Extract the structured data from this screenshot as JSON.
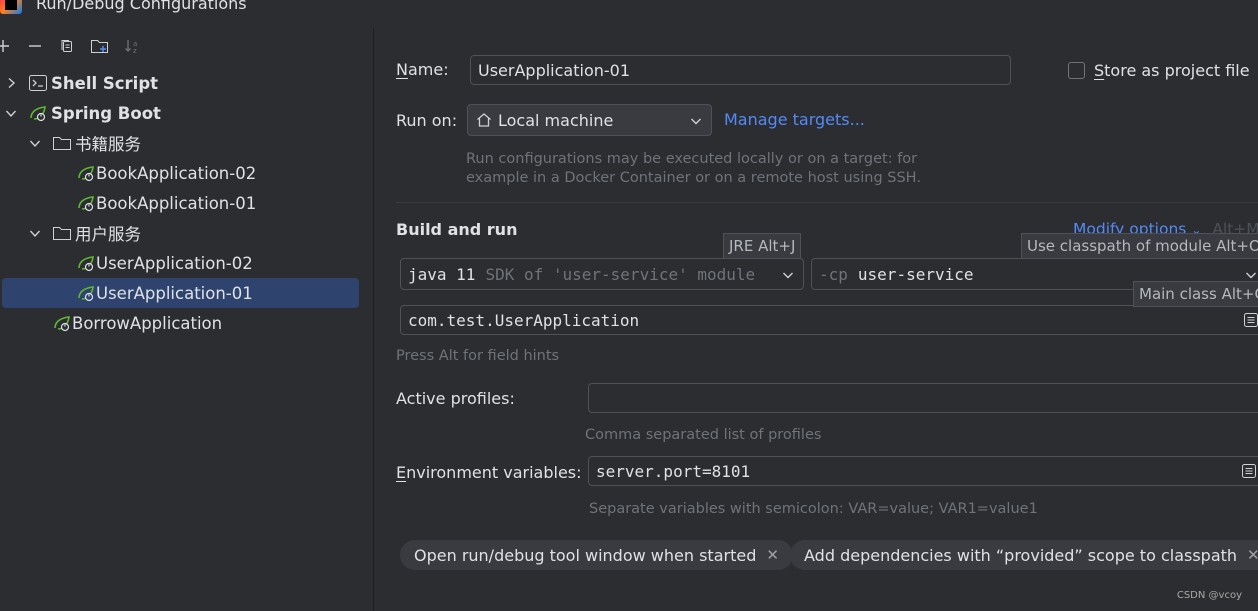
{
  "window": {
    "title": "Run/Debug Configurations"
  },
  "tree": {
    "nodes": [
      {
        "label": "Shell Script"
      },
      {
        "label": "Spring Boot"
      },
      {
        "label": "书籍服务"
      },
      {
        "label": "BookApplication-02"
      },
      {
        "label": "BookApplication-01"
      },
      {
        "label": "用户服务"
      },
      {
        "label": "UserApplication-02"
      },
      {
        "label": "UserApplication-01"
      },
      {
        "label": "BorrowApplication"
      }
    ]
  },
  "form": {
    "name_label_first": "N",
    "name_label_rest": "ame:",
    "name_value": "UserApplication-01",
    "store_first": "S",
    "store_rest": "tore as project file",
    "run_on_label": "Run on:",
    "run_on_value": "Local machine",
    "manage_targets": "Manage targets...",
    "run_on_hint_1": "Run configurations may be executed locally or on a target: for",
    "run_on_hint_2": "example in a Docker Container or on a remote host using SSH.",
    "build_title": "Build and run",
    "modify_options": "Modify options",
    "modify_shortcut": "Alt+M",
    "jre_tooltip": "JRE Alt+J",
    "classpath_tooltip": "Use classpath of module Alt+O",
    "mainclass_tooltip": "Main class Alt+C",
    "sdk_value": "java 11",
    "sdk_detail": "SDK of 'user-service' module",
    "cp_flag": "-cp",
    "cp_value": "user-service",
    "main_class": "com.test.UserApplication",
    "field_hint": "Press Alt for field hints",
    "profiles_label": "Active profiles:",
    "profiles_value": "",
    "profiles_hint": "Comma separated list of profiles",
    "env_label_first": "E",
    "env_label_rest": "nvironment variables:",
    "env_value": "server.port=8101",
    "env_hint": "Separate variables with semicolon: VAR=value; VAR1=value1",
    "chips": [
      "Open run/debug tool window when started",
      "Add dependencies with “provided” scope to classpath"
    ]
  },
  "watermark": "CSDN @vcoy",
  "colors": {
    "accent": "#548af7",
    "selection": "#2e436e",
    "spring_icon": "#5fb832"
  }
}
